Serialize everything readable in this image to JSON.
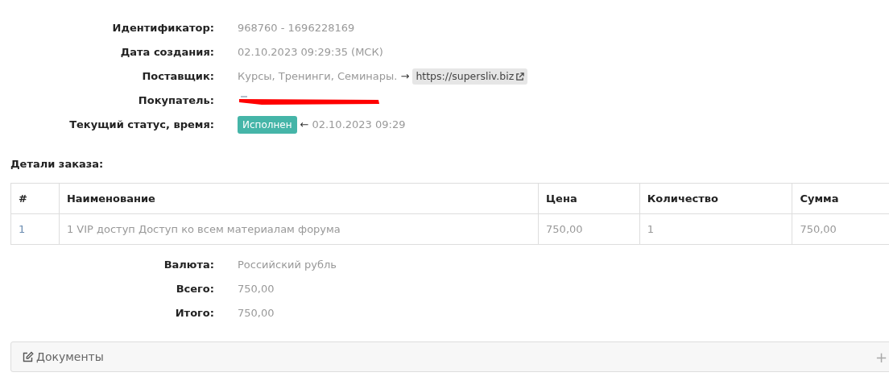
{
  "details": [
    {
      "kind": "text",
      "label": "Идентификатор:",
      "value": "968760 - 1696228169"
    },
    {
      "kind": "text",
      "label": "Дата создания:",
      "value": "02.10.2023 09:29:35 (МСК)"
    },
    {
      "kind": "supplier",
      "label": "Поставщик:",
      "value": "Курсы, Тренинги, Семинары.",
      "arrow": "→",
      "link": "https://supersliv.biz"
    },
    {
      "kind": "redacted",
      "label": "Покупатель:"
    },
    {
      "kind": "status",
      "label": "Текущий статус, время:",
      "badge": "Исполнен",
      "arrow": "←",
      "value": "02.10.2023 09:29"
    }
  ],
  "order_title": "Детали заказа:",
  "table": {
    "columns": [
      "#",
      "Наименование",
      "Цена",
      "Количество",
      "Сумма"
    ],
    "rows": [
      [
        "1",
        "1 VIP доступ Доступ ко всем материалам форума",
        "750,00",
        "1",
        "750,00"
      ]
    ]
  },
  "summary": [
    {
      "label": "Валюта:",
      "value": "Российский рубль"
    },
    {
      "label": "Всего:",
      "value": "750,00"
    },
    {
      "label": "Итого:",
      "value": "750,00"
    }
  ],
  "documents_panel": {
    "title": "Документы",
    "toggle": "+"
  }
}
